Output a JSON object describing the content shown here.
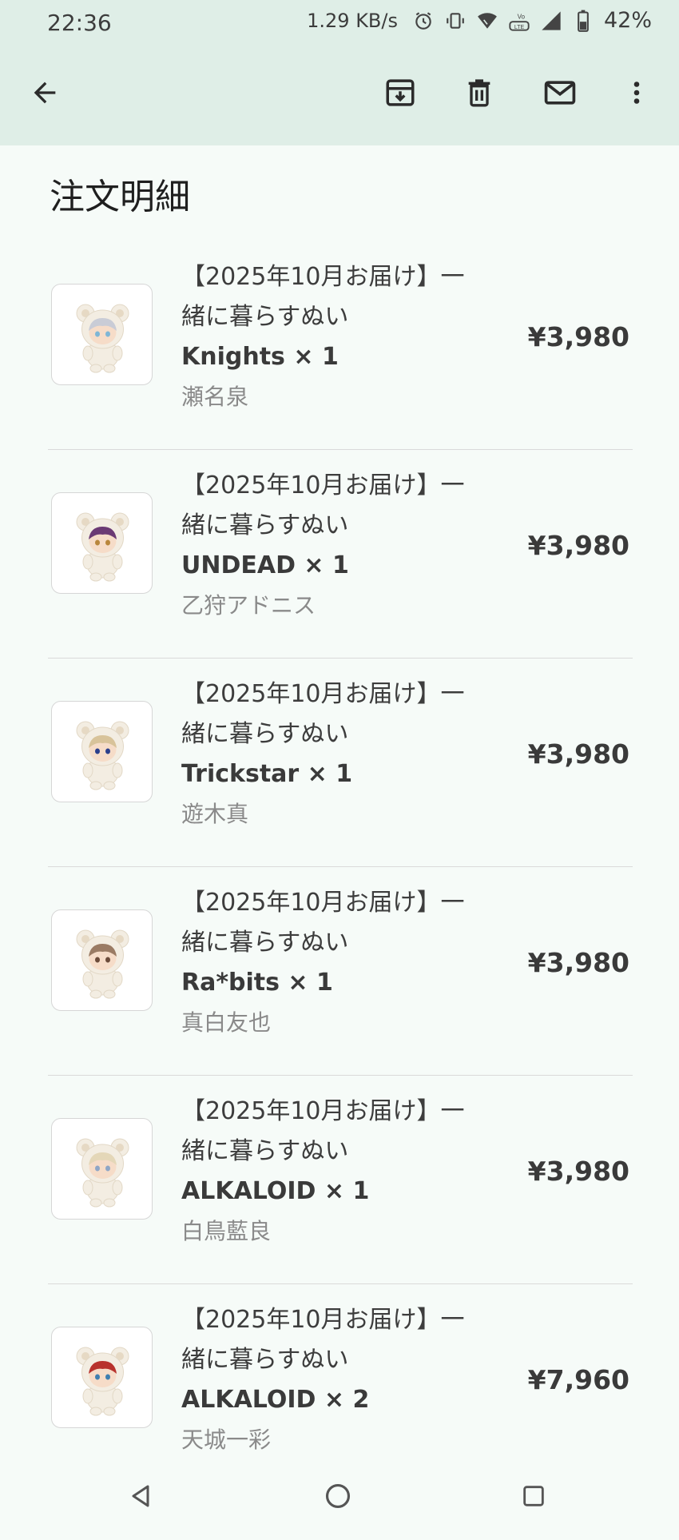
{
  "status_bar": {
    "time": "22:36",
    "network_speed": "1.29 KB/s",
    "battery_percent": "42%",
    "icons": [
      "alarm-icon",
      "vibrate-icon",
      "wifi-icon",
      "volte-icon",
      "signal-icon",
      "battery-icon"
    ]
  },
  "app_bar": {
    "icons": [
      "back-arrow-icon",
      "archive-icon",
      "trash-icon",
      "mail-icon",
      "more-vert-icon"
    ]
  },
  "section_title": "注文明細",
  "items": [
    {
      "title_line1": "【2025年10月お届け】一",
      "title_line2": "緒に暮らすぬい",
      "variant": "Knights × 1",
      "character": "瀬名泉",
      "price": "¥3,980",
      "hair_color": "#c9ccd6",
      "accent_color": "#7fb6d6"
    },
    {
      "title_line1": "【2025年10月お届け】一",
      "title_line2": "緒に暮らすぬい",
      "variant": "UNDEAD × 1",
      "character": "乙狩アドニス",
      "price": "¥3,980",
      "hair_color": "#6b3a74",
      "accent_color": "#b9863c"
    },
    {
      "title_line1": "【2025年10月お届け】一",
      "title_line2": "緒に暮らすぬい",
      "variant": "Trickstar × 1",
      "character": "遊木真",
      "price": "¥3,980",
      "hair_color": "#d8c39a",
      "accent_color": "#2c3f8c"
    },
    {
      "title_line1": "【2025年10月お届け】一",
      "title_line2": "緒に暮らすぬい",
      "variant": "Ra*bits × 1",
      "character": "真白友也",
      "price": "¥3,980",
      "hair_color": "#9a7b64",
      "accent_color": "#6c4b3a"
    },
    {
      "title_line1": "【2025年10月お届け】一",
      "title_line2": "緒に暮らすぬい",
      "variant": "ALKALOID × 1",
      "character": "白鳥藍良",
      "price": "¥3,980",
      "hair_color": "#e4d7b8",
      "accent_color": "#8fa6c6"
    },
    {
      "title_line1": "【2025年10月お届け】一",
      "title_line2": "緒に暮らすぬい",
      "variant": "ALKALOID × 2",
      "character": "天城一彩",
      "price": "¥7,960",
      "hair_color": "#b8322d",
      "accent_color": "#3f7fb0"
    }
  ],
  "nav_bar": {
    "icons": [
      "nav-back-icon",
      "nav-home-icon",
      "nav-recents-icon"
    ]
  },
  "colors": {
    "app_bar_bg": "#dfeee7",
    "content_bg": "#f6fbf8",
    "divider": "#dadada",
    "text_primary": "#3a3a3a",
    "text_secondary": "#8a8a8a"
  }
}
